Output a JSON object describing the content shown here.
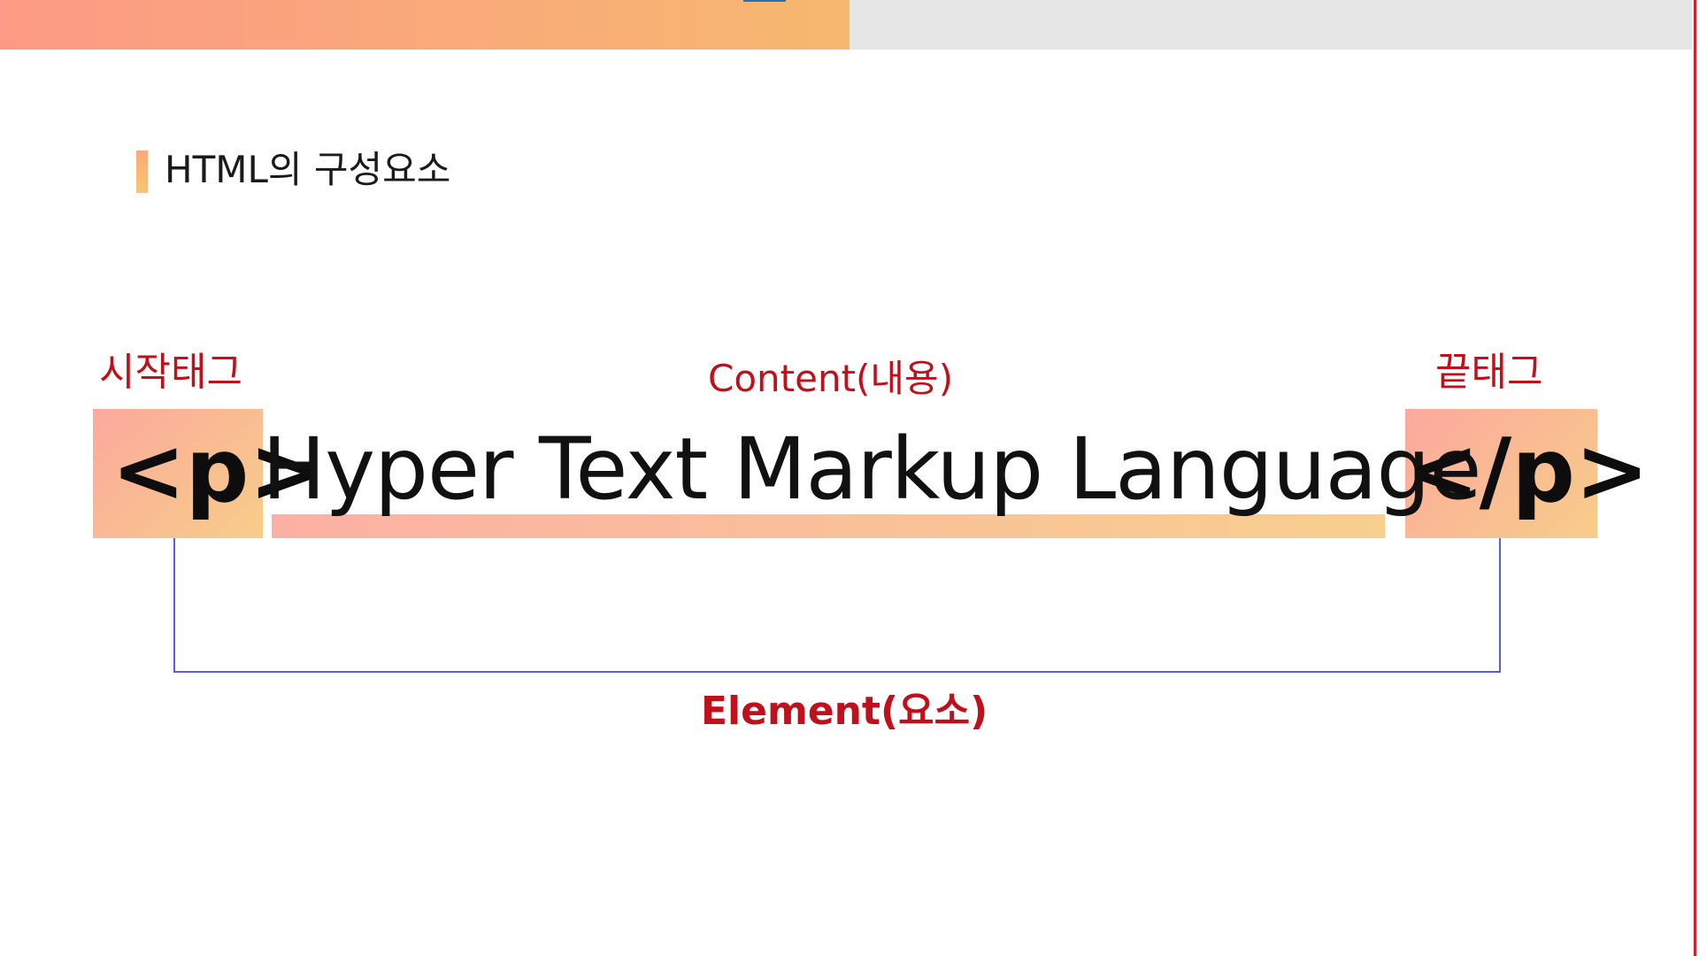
{
  "colors": {
    "accent_red": "#c0101b",
    "gradient_start": "#fc9a85",
    "gradient_end": "#f6b86f",
    "bracket_line": "#5a5ae8"
  },
  "header": {
    "section_title": "HTML의 구성요소"
  },
  "diagram": {
    "start_tag_label": "시작태그",
    "content_label": "Content(내용)",
    "end_tag_label": "끝태그",
    "start_tag": "<p>",
    "content": "Hyper Text Markup Language",
    "end_tag": "</p>",
    "element_label": "Element(요소)"
  }
}
